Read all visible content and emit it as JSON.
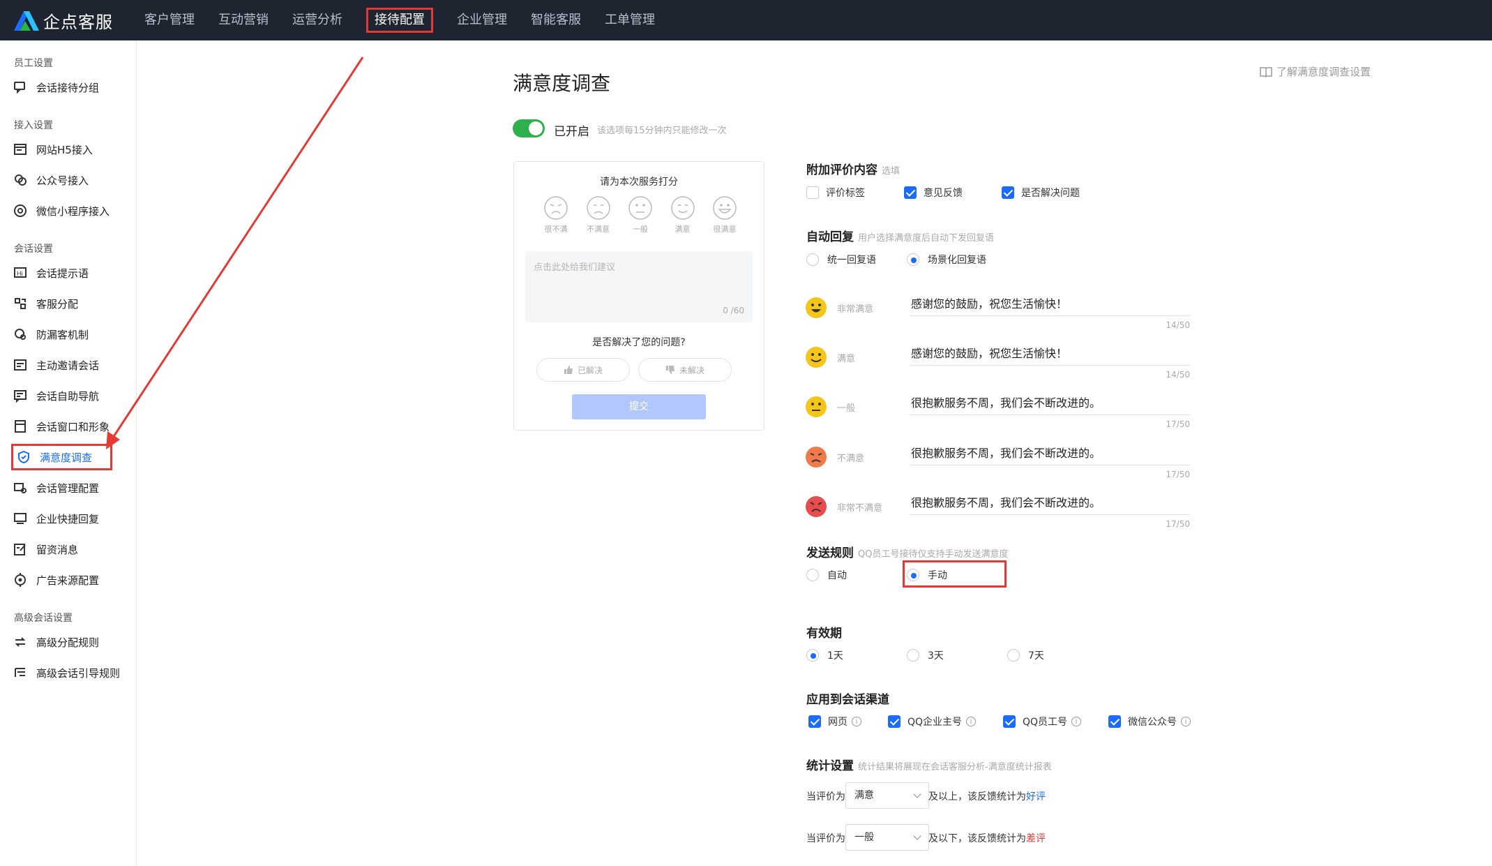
{
  "brand": {
    "name": "企点客服"
  },
  "nav": [
    {
      "label": "客户管理",
      "active": false
    },
    {
      "label": "互动营销",
      "active": false
    },
    {
      "label": "运营分析",
      "active": false
    },
    {
      "label": "接待配置",
      "active": true
    },
    {
      "label": "企业管理",
      "active": false
    },
    {
      "label": "智能客服",
      "active": false
    },
    {
      "label": "工单管理",
      "active": false
    }
  ],
  "sidebar": {
    "groups": [
      "员工设置",
      "接入设置",
      "会话设置",
      "高级会话设置"
    ],
    "items": [
      {
        "label": "会话接待分组",
        "icon": "chat-group-icon"
      },
      {
        "label": "网站H5接入",
        "icon": "web-h5-icon"
      },
      {
        "label": "公众号接入",
        "icon": "official-account-icon"
      },
      {
        "label": "微信小程序接入",
        "icon": "mini-program-icon"
      },
      {
        "label": "会话提示语",
        "icon": "prompt-icon"
      },
      {
        "label": "客服分配",
        "icon": "assign-icon"
      },
      {
        "label": "防漏客机制",
        "icon": "prevent-loss-icon"
      },
      {
        "label": "主动邀请会话",
        "icon": "invite-icon"
      },
      {
        "label": "会话自助导航",
        "icon": "self-nav-icon"
      },
      {
        "label": "会话窗口和形象",
        "icon": "window-icon"
      },
      {
        "label": "满意度调查",
        "icon": "satisfaction-shield-icon",
        "active": true
      },
      {
        "label": "会话管理配置",
        "icon": "session-config-icon"
      },
      {
        "label": "企业快捷回复",
        "icon": "quick-reply-icon"
      },
      {
        "label": "留资消息",
        "icon": "lead-message-icon"
      },
      {
        "label": "广告来源配置",
        "icon": "ad-source-icon"
      },
      {
        "label": "高级分配规则",
        "icon": "advanced-assign-icon"
      },
      {
        "label": "高级会话引导规则",
        "icon": "guide-rule-icon"
      }
    ]
  },
  "page": {
    "title": "满意度调查",
    "help_link": "了解满意度调查设置",
    "toggle_label": "已开启",
    "toggle_note": "该选项每15分钟内只能修改一次"
  },
  "preview": {
    "title": "请为本次服务打分",
    "faces": [
      "很不满",
      "不满意",
      "一般",
      "满意",
      "很满意"
    ],
    "placeholder": "点击此处给我们建议",
    "count": "0 /60",
    "question": "是否解决了您的问题?",
    "solved": "已解决",
    "unsolved": "未解决",
    "submit": "提交"
  },
  "extra": {
    "title": "附加评价内容",
    "note": "选填",
    "options": [
      {
        "label": "评价标签",
        "checked": false
      },
      {
        "label": "意见反馈",
        "checked": true
      },
      {
        "label": "是否解决问题",
        "checked": true
      }
    ]
  },
  "auto_reply": {
    "title": "自动回复",
    "note": "用户选择满意度后自动下发回复语",
    "modes": [
      {
        "label": "统一回复语",
        "selected": false
      },
      {
        "label": "场景化回复语",
        "selected": true
      }
    ],
    "rows": [
      {
        "label": "非常满意",
        "text": "感谢您的鼓励，祝您生活愉快！",
        "count": "14/50",
        "color": "#f5c518"
      },
      {
        "label": "满意",
        "text": "感谢您的鼓励，祝您生活愉快！",
        "count": "14/50",
        "color": "#f5c518"
      },
      {
        "label": "一般",
        "text": "很抱歉服务不周，我们会不断改进的。",
        "count": "17/50",
        "color": "#f5c518"
      },
      {
        "label": "不满意",
        "text": "很抱歉服务不周，我们会不断改进的。",
        "count": "17/50",
        "color": "#f07a4a"
      },
      {
        "label": "非常不满意",
        "text": "很抱歉服务不周，我们会不断改进的。",
        "count": "17/50",
        "color": "#e84c4c"
      }
    ]
  },
  "send_rule": {
    "title": "发送规则",
    "note": "QQ员工号接待仅支持手动发送满意度",
    "options": [
      {
        "label": "自动",
        "selected": false
      },
      {
        "label": "手动",
        "selected": true
      }
    ]
  },
  "validity": {
    "title": "有效期",
    "options": [
      {
        "label": "1天",
        "selected": true
      },
      {
        "label": "3天",
        "selected": false
      },
      {
        "label": "7天",
        "selected": false
      }
    ]
  },
  "channels": {
    "title": "应用到会话渠道",
    "options": [
      {
        "label": "网页",
        "checked": true
      },
      {
        "label": "QQ企业主号",
        "checked": true
      },
      {
        "label": "QQ员工号",
        "checked": true
      },
      {
        "label": "微信公众号",
        "checked": true
      }
    ]
  },
  "stats": {
    "title": "统计设置",
    "note": "统计结果将展现在会话客服分析-满意度统计报表",
    "line1": {
      "prefix": "当评价为",
      "value": "满意",
      "mid": "及以上，该反馈统计为",
      "result": "好评"
    },
    "line2": {
      "prefix": "当评价为",
      "value": "一般",
      "mid": "及以下，该反馈统计为",
      "result": "差评"
    }
  },
  "colors": {
    "accent": "#1a6cff",
    "toggle_on": "#2bb24c",
    "highlight": "#e53935",
    "topbar": "#1f2431"
  }
}
